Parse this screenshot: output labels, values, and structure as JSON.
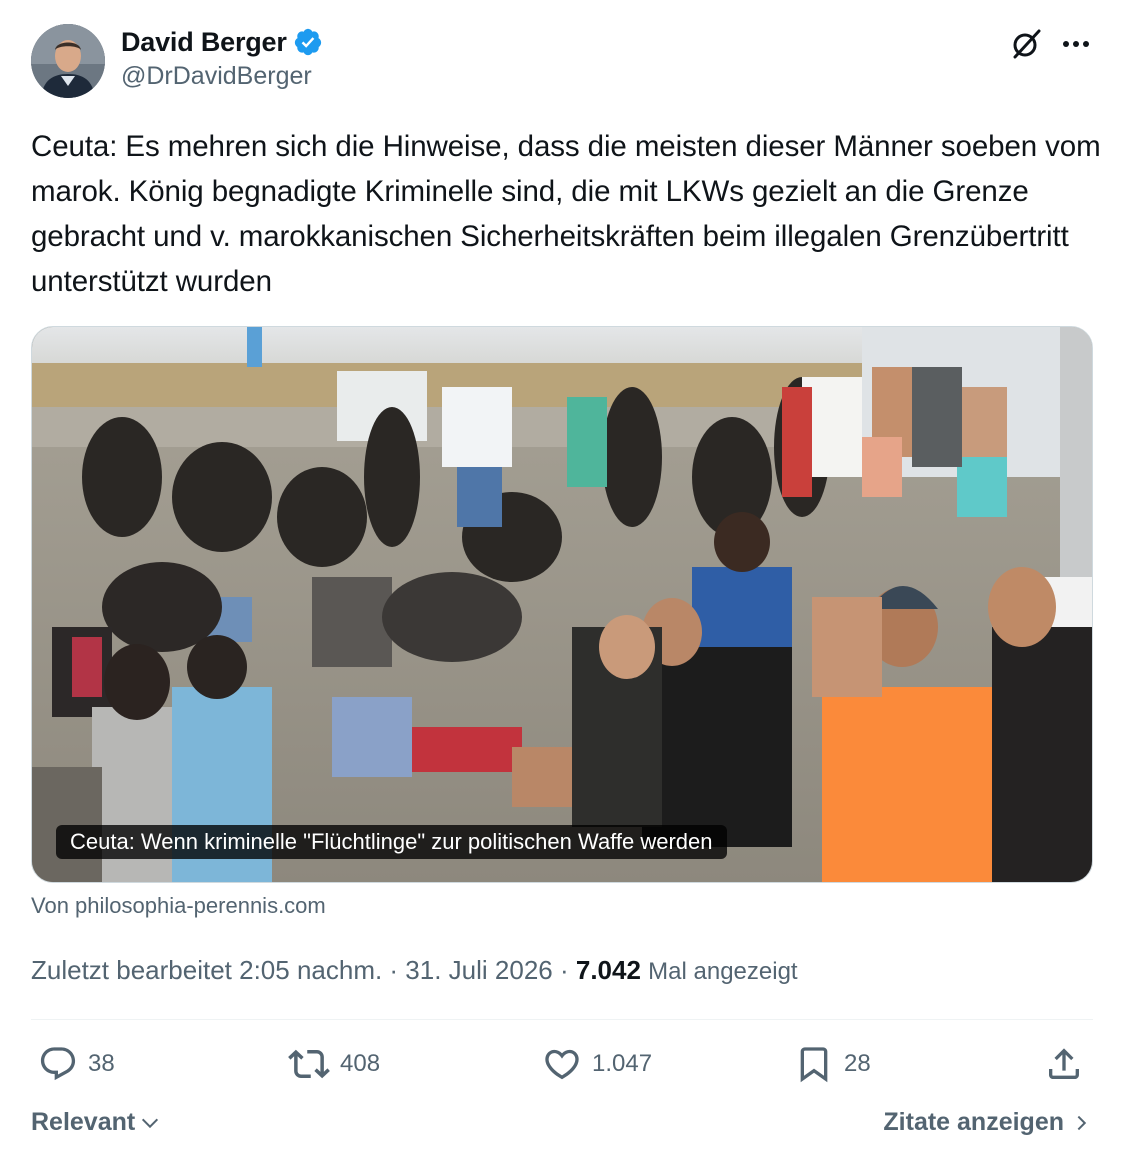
{
  "author": {
    "display_name": "David Berger",
    "handle": "@DrDavidBerger",
    "verified": true,
    "avatar_icon": "profile-photo",
    "verified_color": "#1d9bf0"
  },
  "header_icons": {
    "grok": "grok-icon",
    "more": "more-options-icon"
  },
  "tweet": {
    "text": "Ceuta: Es mehren sich die Hinweise, dass die meisten dieser Männer soeben vom marok. König begnadigte Kriminelle sind, die mit LKWs gezielt an die Grenze gebracht und v. marokkanischen Sicherheitskräften beim illegalen Grenzübertritt unterstützt wurden"
  },
  "card": {
    "image_icon": "beach-crowd-photo",
    "caption": "Ceuta: Wenn kriminelle \"Flüchtlinge\" zur politischen Waffe werden",
    "source": "Von philosophia-perennis.com"
  },
  "meta": {
    "edited": "Zuletzt bearbeitet 2:05 nachm. · 31. Juli 2026 · ",
    "views_count": "7.042",
    "views_label": "Mal angezeigt"
  },
  "actions": {
    "replies": "38",
    "reposts": "408",
    "likes": "1.047",
    "bookmarks": "28",
    "share_icon": "share-icon"
  },
  "footer": {
    "sort_label": "Relevant",
    "quotes_label": "Zitate anzeigen"
  },
  "colors": {
    "text_primary": "#0f1419",
    "text_secondary": "#536471",
    "accent": "#1d9bf0",
    "divider": "#eff3f4"
  }
}
